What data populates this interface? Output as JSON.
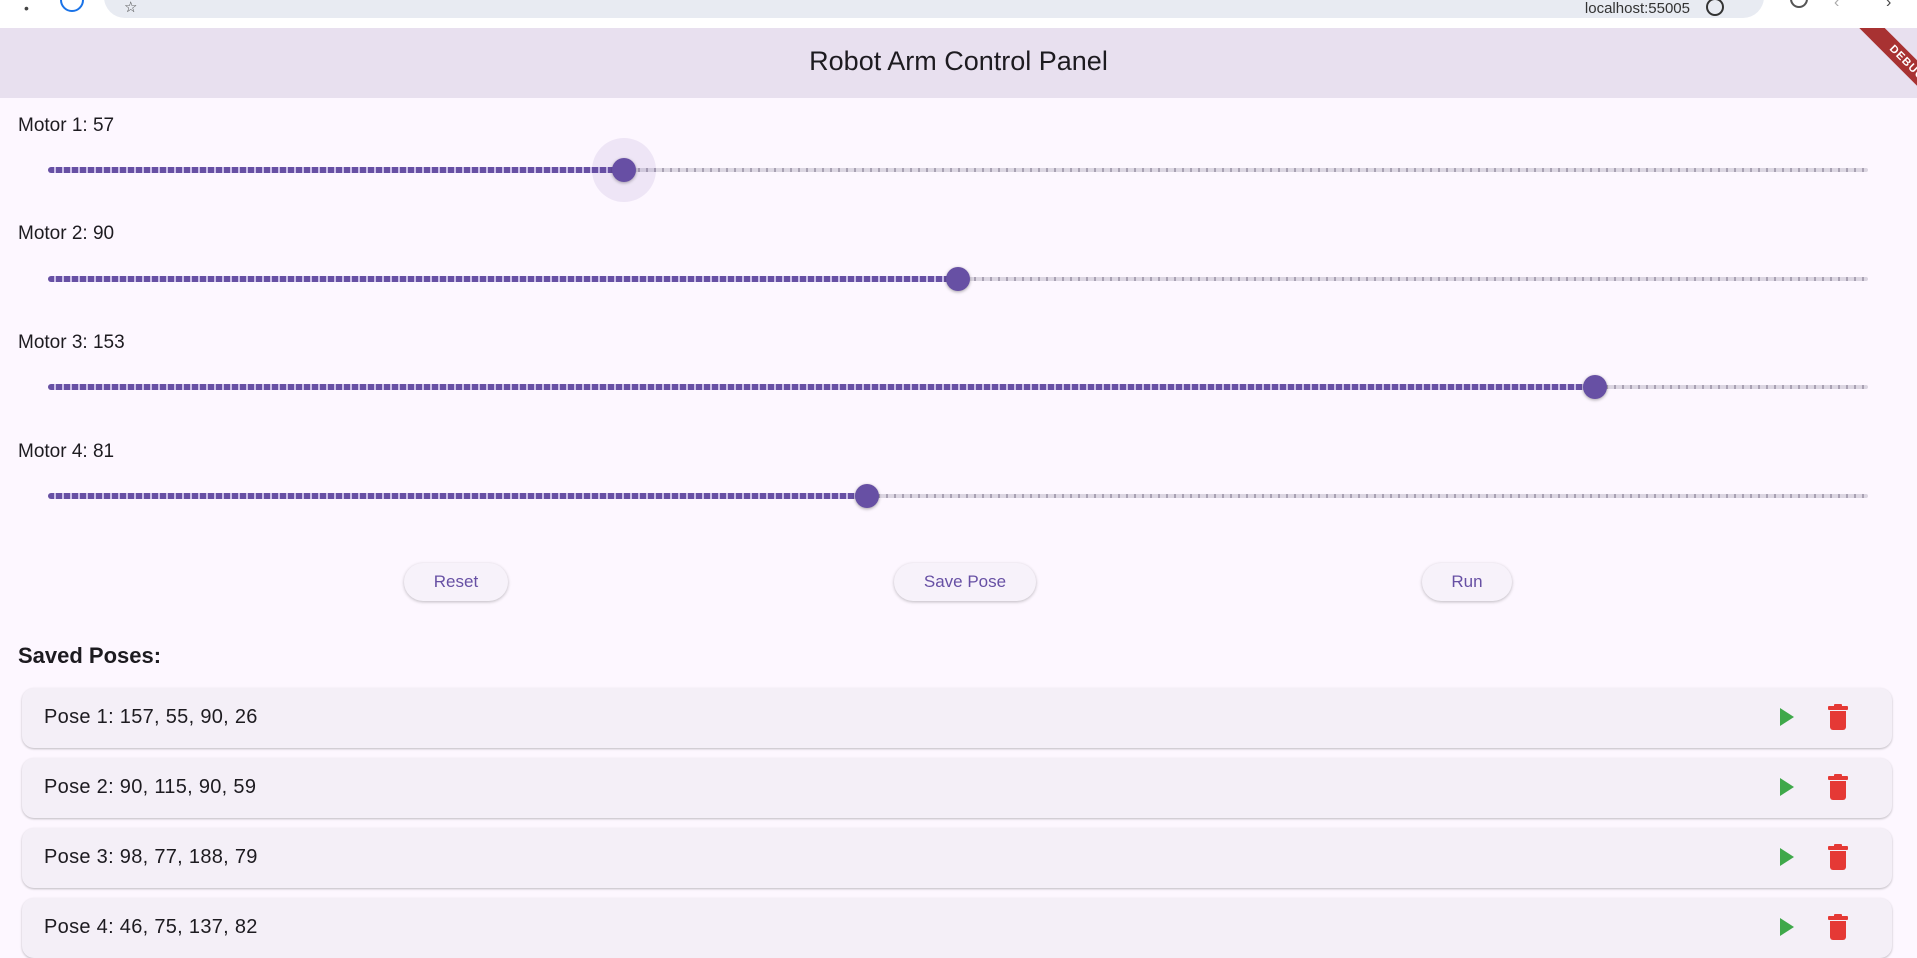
{
  "browser": {
    "url": "localhost:55005"
  },
  "app": {
    "title": "Robot Arm Control Panel",
    "debug_label": "DEBUG"
  },
  "motors": [
    {
      "label": "Motor 1: 57",
      "value": 57,
      "max": 180
    },
    {
      "label": "Motor 2: 90",
      "value": 90,
      "max": 180
    },
    {
      "label": "Motor 3: 153",
      "value": 153,
      "max": 180
    },
    {
      "label": "Motor 4: 81",
      "value": 81,
      "max": 180
    }
  ],
  "actions": {
    "reset_label": "Reset",
    "save_label": "Save Pose",
    "run_label": "Run"
  },
  "saved_poses": {
    "title": "Saved Poses:",
    "items": [
      {
        "label": "Pose 1: 157, 55, 90, 26"
      },
      {
        "label": "Pose 2: 90, 115, 90, 59"
      },
      {
        "label": "Pose 3: 98, 77, 188, 79"
      },
      {
        "label": "Pose 4: 46, 75, 137, 82"
      }
    ]
  },
  "colors": {
    "primary": "#6750a4",
    "play": "#3fa84a",
    "delete": "#e53935",
    "app_bar": "#e8e0ef",
    "background": "#fdf7ff"
  }
}
